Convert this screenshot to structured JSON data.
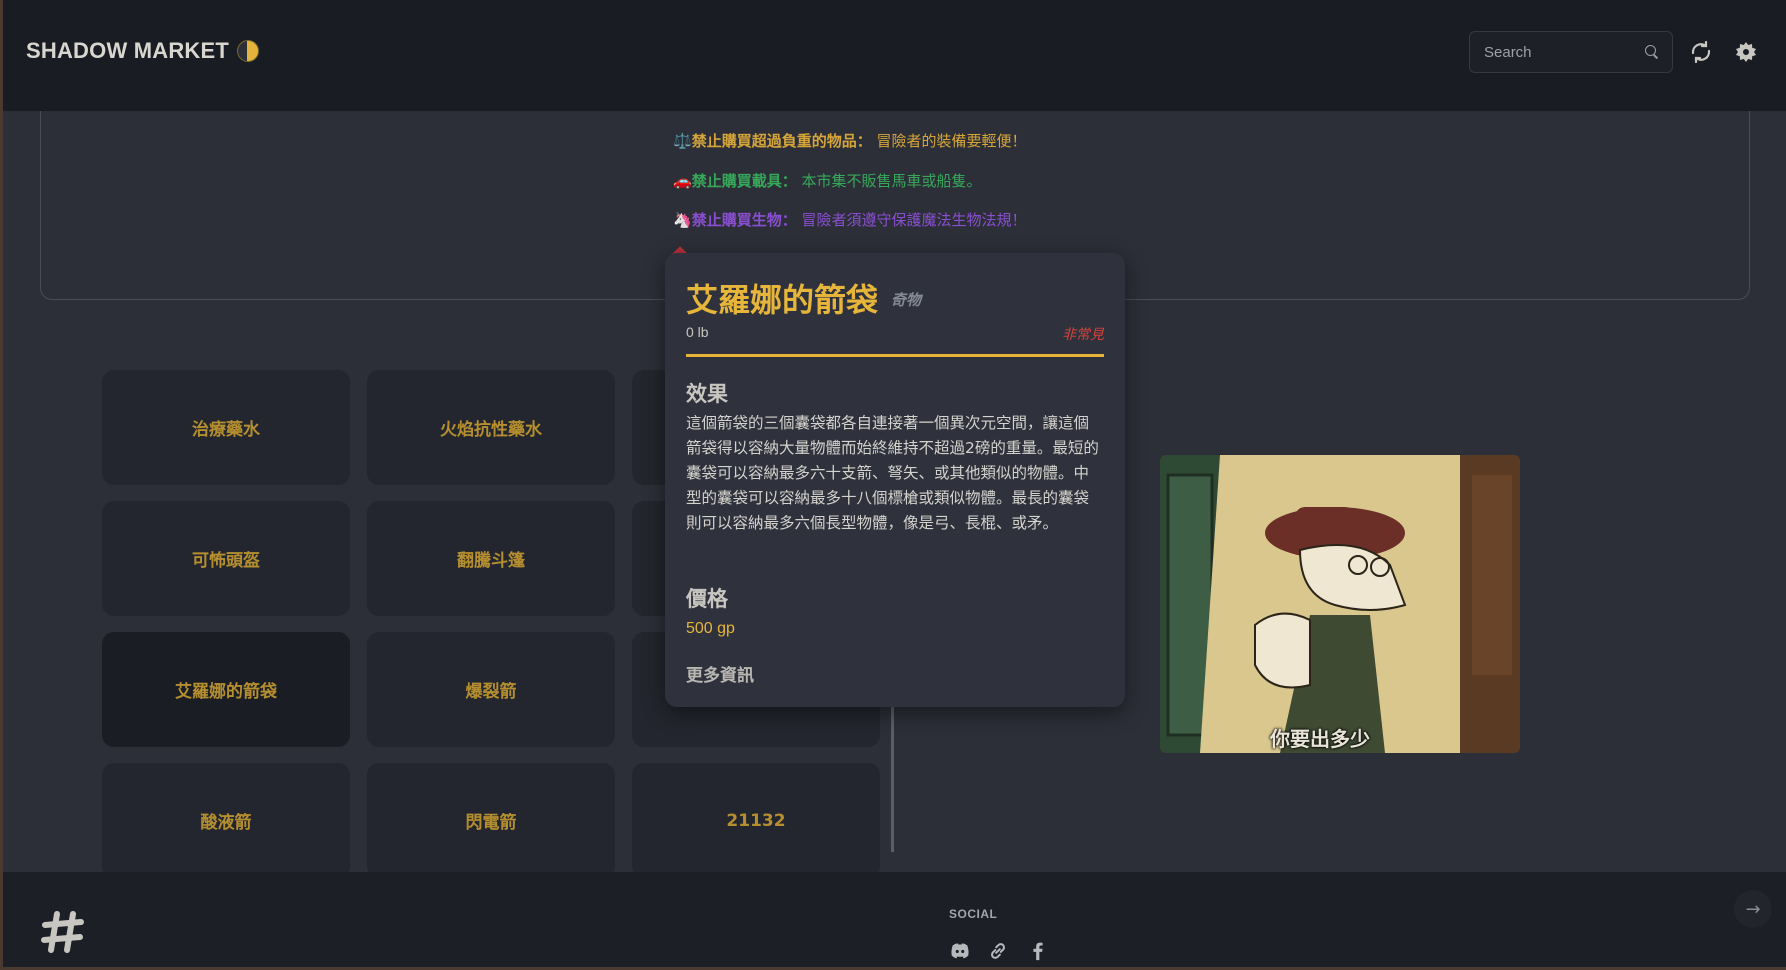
{
  "header": {
    "brand": "SHADOW MARKET",
    "search_placeholder": "Search",
    "icons": [
      "moon-icon",
      "search-icon",
      "refresh-icon",
      "settings-icon"
    ]
  },
  "rules": [
    {
      "emoji": "⚖️",
      "title": "禁止購買超過負重的物品：",
      "text": " 冒險者的裝備要輕便！",
      "title_color": "#d5a53a",
      "text_color": "#d5a53a"
    },
    {
      "emoji": "🚗",
      "title": "禁止購買載具：",
      "text": " 本市集不販售馬車或船隻。",
      "title_color": "#37a85a",
      "text_color": "#37a85a"
    },
    {
      "emoji": "🦄",
      "title": "禁止購買生物：",
      "text": " 冒險者須遵守保護魔法生物法規！",
      "title_color": "#8a4fd0",
      "text_color": "#8a4fd0"
    }
  ],
  "items": [
    {
      "name": "治療藥水"
    },
    {
      "name": "火焰抗性藥水"
    },
    {
      "name": ""
    },
    {
      "name": "可怖頭盔"
    },
    {
      "name": "翻騰斗篷"
    },
    {
      "name": ""
    },
    {
      "name": "艾羅娜的箭袋"
    },
    {
      "name": "爆裂箭"
    },
    {
      "name": ""
    },
    {
      "name": "酸液箭"
    },
    {
      "name": "閃電箭"
    },
    {
      "name": "21132"
    }
  ],
  "tooltip": {
    "name": "艾羅娜的箭袋",
    "type": "奇物",
    "weight": "0 lb",
    "rarity": "非常見",
    "effect_heading": "效果",
    "effect_text": "這個箭袋的三個囊袋都各自連接著一個異次元空間，讓這個箭袋得以容納大量物體而始終維持不超過2磅的重量。最短的囊袋可以容納最多六十支箭、弩矢、或其他類似的物體。中型的囊袋可以容納最多十八個標槍或類似物體。最長的囊袋則可以容納最多六個長型物體，像是弓、長棍、或矛。",
    "price_heading": "價格",
    "price": "500 gp",
    "more_info": "更多資訊"
  },
  "meme": {
    "caption": "你要出多少"
  },
  "footer": {
    "social_label": "SOCIAL",
    "social_icons": [
      "discord-icon",
      "link-icon",
      "facebook-icon"
    ],
    "arrow_icon": "arrow-right-icon"
  },
  "colors": {
    "accent": "#e6b53a",
    "rarity": "#d6423a",
    "background": "#2c2f38",
    "header": "#191c22"
  }
}
